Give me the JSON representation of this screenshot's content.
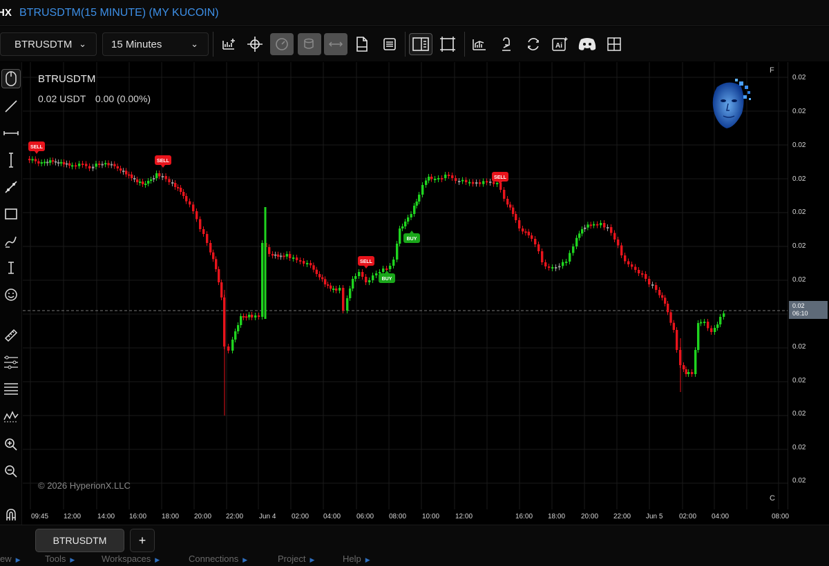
{
  "app": {
    "logo": "HX",
    "title": "BTRUSDTM(15 MINUTE) (MY KUCOIN)"
  },
  "toolbar": {
    "symbol": "BTRUSDTM",
    "timeframe": "15 Minutes",
    "buttons": [
      "add-indicator",
      "crosshair",
      "replay",
      "database",
      "compare",
      "document",
      "notes",
      "layout-panel",
      "screenshot",
      "chart-stats",
      "alert",
      "refresh",
      "ai",
      "discord",
      "grid"
    ]
  },
  "chart": {
    "symbol": "BTRUSDTM",
    "last_price": "0.02 USDT",
    "change": "0.00 (0.00%)",
    "copyright": "© 2026 HyperionX.LLC",
    "axis_flag_top": "F",
    "axis_flag_bottom": "C",
    "countdown_price": "0.02",
    "countdown_time": "06:10"
  },
  "price_axis_labels": [
    "0.02",
    "0.02",
    "0.02",
    "0.02",
    "0.02",
    "0.02",
    "0.02",
    "0.02",
    "0.02",
    "0.02",
    "0.02",
    "0.02",
    "0.02"
  ],
  "time_axis_labels": [
    "09:45",
    "12:00",
    "14:00",
    "16:00",
    "18:00",
    "20:00",
    "22:00",
    "Jun 4",
    "02:00",
    "04:00",
    "06:00",
    "08:00",
    "10:00",
    "12:00",
    "16:00",
    "18:00",
    "20:00",
    "22:00",
    "Jun 5",
    "02:00",
    "04:00",
    "08:00"
  ],
  "signals": [
    {
      "label": "SELL",
      "type": "sell"
    },
    {
      "label": "SELL",
      "type": "sell"
    },
    {
      "label": "SELL",
      "type": "sell"
    },
    {
      "label": "BUY",
      "type": "buy"
    },
    {
      "label": "BUY",
      "type": "buy"
    },
    {
      "label": "SELL",
      "type": "sell"
    }
  ],
  "colors": {
    "bull": "#1fd41f",
    "bear": "#e8141c",
    "neutral": "#9a9a9a",
    "accent": "#3d8fe6"
  },
  "bottom": {
    "tab": "BTRUSDTM",
    "add": "+"
  },
  "menu": [
    "ew",
    "Tools",
    "Workspaces",
    "Connections",
    "Project",
    "Help"
  ]
}
